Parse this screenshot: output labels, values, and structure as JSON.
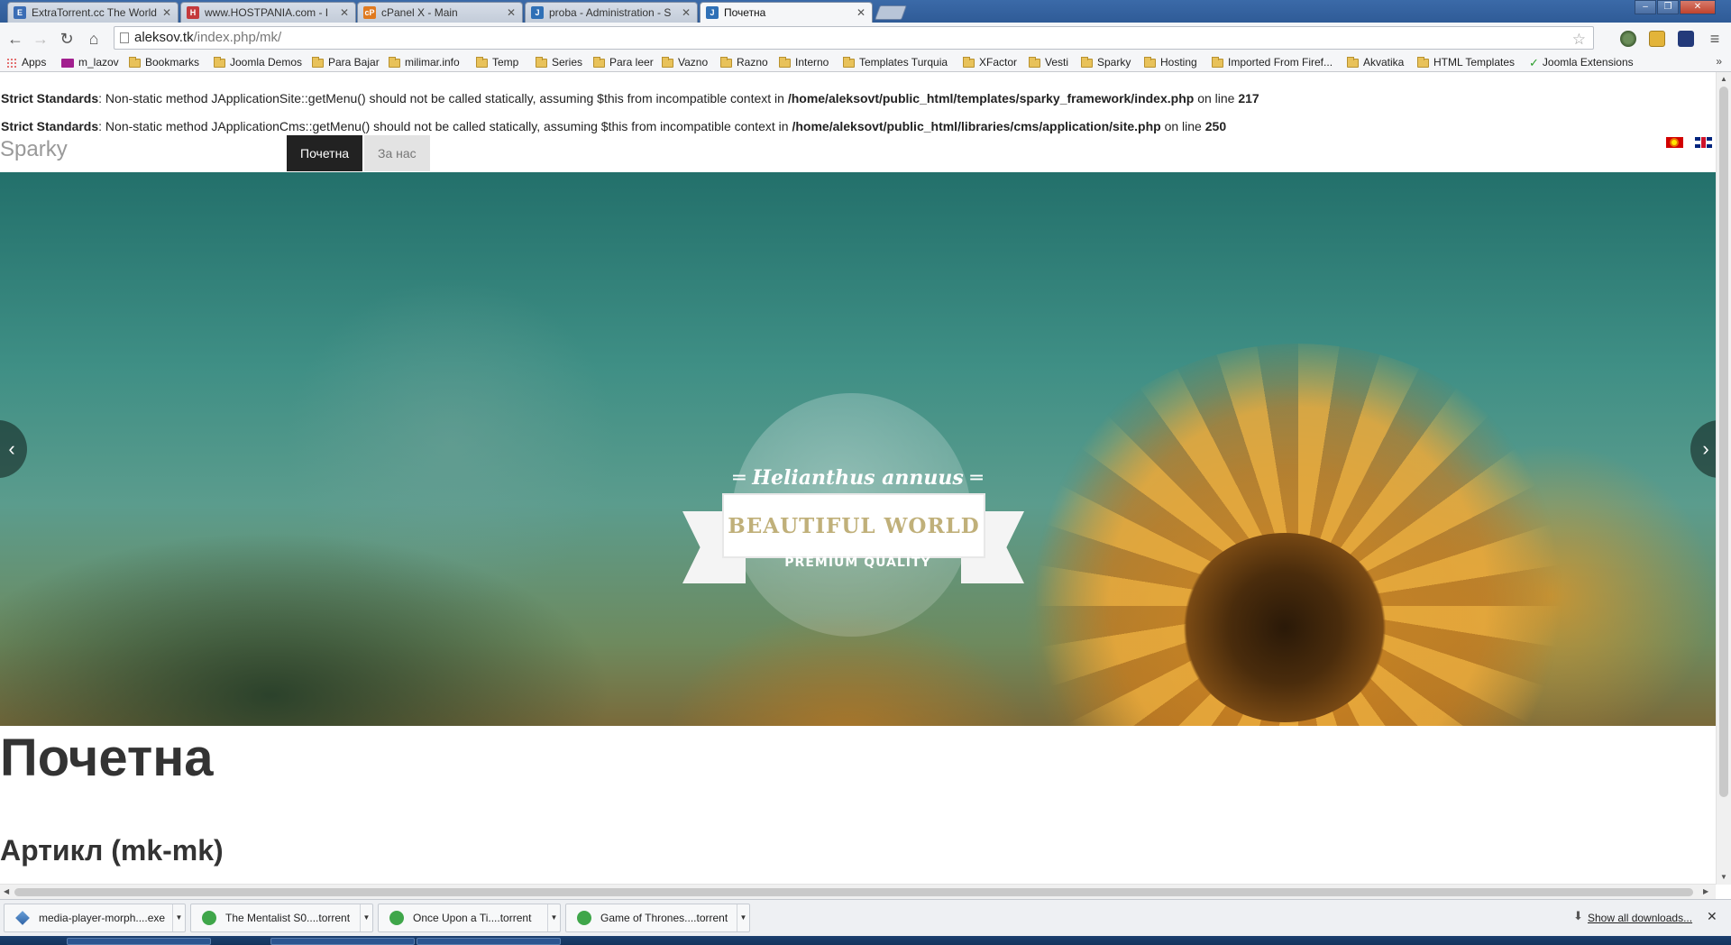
{
  "tabs": [
    {
      "title": "ExtraTorrent.cc The World",
      "icon": "extratorrent-icon",
      "color": "#3b6db5"
    },
    {
      "title": "www.HOSTPANIA.com - I",
      "icon": "hostpania-icon",
      "color": "#c4393b"
    },
    {
      "title": "cPanel X - Main",
      "icon": "cpanel-icon",
      "color": "#e07a1f"
    },
    {
      "title": "proba - Administration - S",
      "icon": "joomla-icon",
      "color": "#2f70b6"
    },
    {
      "title": "Почетна",
      "icon": "joomla-icon",
      "color": "#2f70b6",
      "active": true
    }
  ],
  "address": {
    "host": "aleksov.tk",
    "path": "/index.php/mk/"
  },
  "bookmarks": [
    {
      "label": "Apps",
      "type": "apps"
    },
    {
      "label": "m_lazov",
      "type": "mail"
    },
    {
      "label": "Bookmarks",
      "type": "folder"
    },
    {
      "label": "Joomla Demos",
      "type": "folder"
    },
    {
      "label": "Para Bajar",
      "type": "folder"
    },
    {
      "label": "milimar.info",
      "type": "folder"
    },
    {
      "label": "Temp",
      "type": "folder"
    },
    {
      "label": "Series",
      "type": "folder"
    },
    {
      "label": "Para leer",
      "type": "folder"
    },
    {
      "label": "Vazno",
      "type": "folder"
    },
    {
      "label": "Razno",
      "type": "folder"
    },
    {
      "label": "Interno",
      "type": "folder"
    },
    {
      "label": "Templates Turquia",
      "type": "folder"
    },
    {
      "label": "XFactor",
      "type": "folder"
    },
    {
      "label": "Vesti",
      "type": "folder"
    },
    {
      "label": "Sparky",
      "type": "folder"
    },
    {
      "label": "Hosting",
      "type": "folder"
    },
    {
      "label": "Imported From Firef...",
      "type": "folder"
    },
    {
      "label": "Akvatika",
      "type": "folder"
    },
    {
      "label": "HTML Templates",
      "type": "folder"
    },
    {
      "label": "Joomla Extensions",
      "type": "check"
    }
  ],
  "warnings": [
    {
      "prefix": "Strict Standards",
      "msg": ": Non-static method JApplicationSite::getMenu() should not be called statically, assuming $this from incompatible context in ",
      "file": "/home/aleksovt/public_html/templates/sparky_framework/index.php",
      "on_line": " on line ",
      "line": "217"
    },
    {
      "prefix": "Strict Standards",
      "msg": ": Non-static method JApplicationCms::getMenu() should not be called statically, assuming $this from incompatible context in ",
      "file": "/home/aleksovt/public_html/libraries/cms/application/site.php",
      "on_line": " on line ",
      "line": "250"
    }
  ],
  "site": {
    "name": "Sparky",
    "menu": [
      {
        "label": "Почетна",
        "active": true
      },
      {
        "label": "За нас",
        "active": false
      }
    ],
    "languages": [
      "mk",
      "en"
    ]
  },
  "slider": {
    "script_text": "Helianthus annuus",
    "banner_text": "BEAUTIFUL WORLD",
    "sub_text": "PREMIUM QUALITY",
    "prev": "‹",
    "next": "›"
  },
  "content": {
    "page_title": "Почетна",
    "article_title": "Артикл (mk-mk)"
  },
  "downloads": [
    {
      "name": "media-player-morph....exe",
      "icon": "exe-icon"
    },
    {
      "name": "The Mentalist S0....torrent",
      "icon": "utorrent-icon"
    },
    {
      "name": "Once Upon a Ti....torrent",
      "icon": "utorrent-icon"
    },
    {
      "name": "Game of Thrones....torrent",
      "icon": "utorrent-icon"
    }
  ],
  "show_all_downloads": "Show all downloads..."
}
